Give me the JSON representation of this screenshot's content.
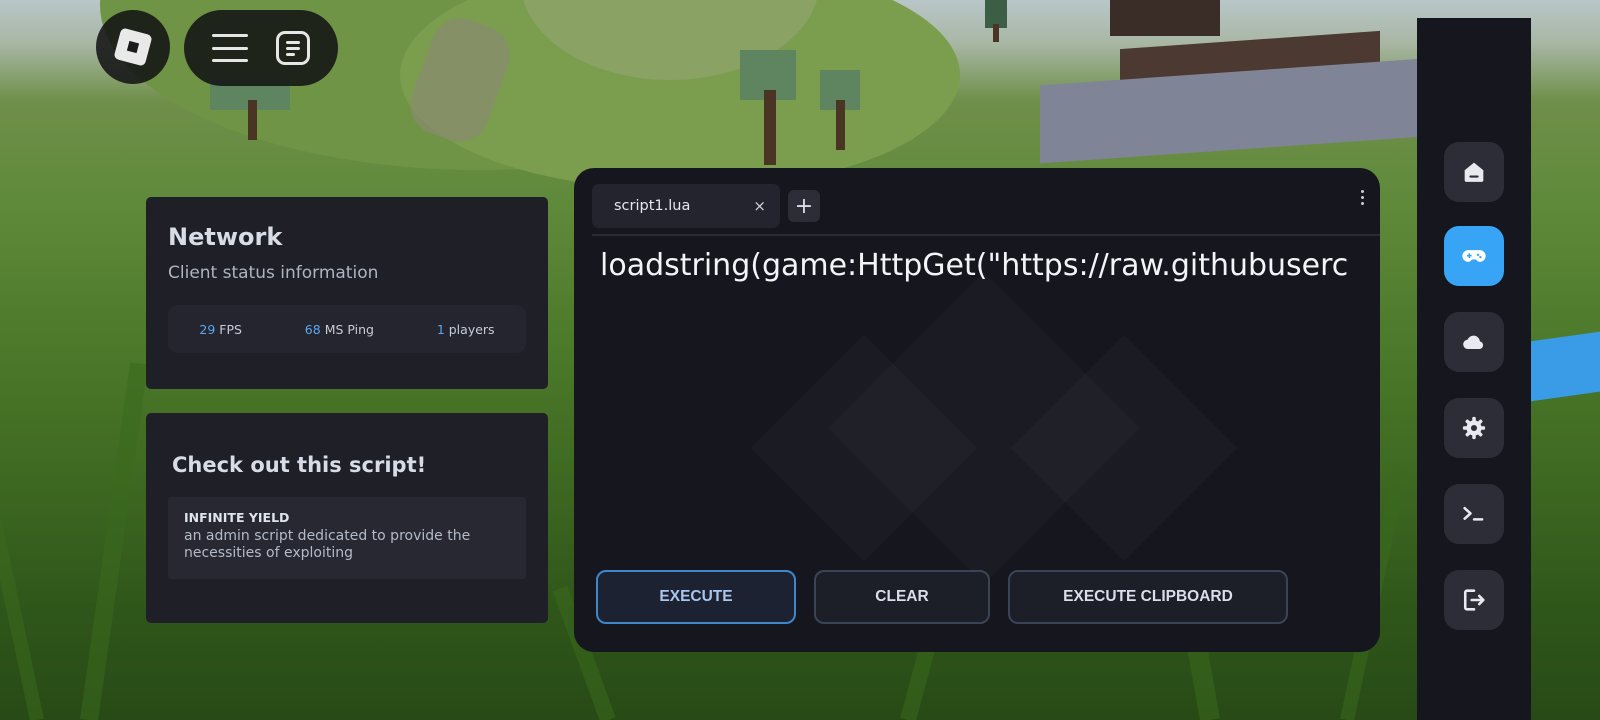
{
  "network": {
    "title": "Network",
    "subtitle": "Client status information",
    "fps_value": "29",
    "fps_label": "FPS",
    "ping_value": "68",
    "ping_label": "MS Ping",
    "players_value": "1",
    "players_label": "players"
  },
  "promo": {
    "heading": "Check out this script!",
    "script_name": "INFINITE YIELD",
    "script_desc": "an admin script dedicated to provide the necessities of exploiting"
  },
  "editor": {
    "tab_label": "script1.lua",
    "tab_close": "×",
    "add_tab": "+",
    "code": "loadstring(game:HttpGet(\"https://raw.githubuserc"
  },
  "actions": {
    "execute": "EXECUTE",
    "clear": "CLEAR",
    "execute_clipboard": "EXECUTE CLIPBOARD"
  },
  "sidebar": {
    "items": [
      {
        "icon": "home-icon",
        "active": false
      },
      {
        "icon": "gamepad-icon",
        "active": true
      },
      {
        "icon": "cloud-icon",
        "active": false
      },
      {
        "icon": "gear-icon",
        "active": false
      },
      {
        "icon": "terminal-icon",
        "active": false
      },
      {
        "icon": "logout-icon",
        "active": false
      }
    ]
  },
  "colors": {
    "accent": "#38a4f6",
    "stat_number": "#5aa7f2",
    "panel": "#1e1f27"
  }
}
